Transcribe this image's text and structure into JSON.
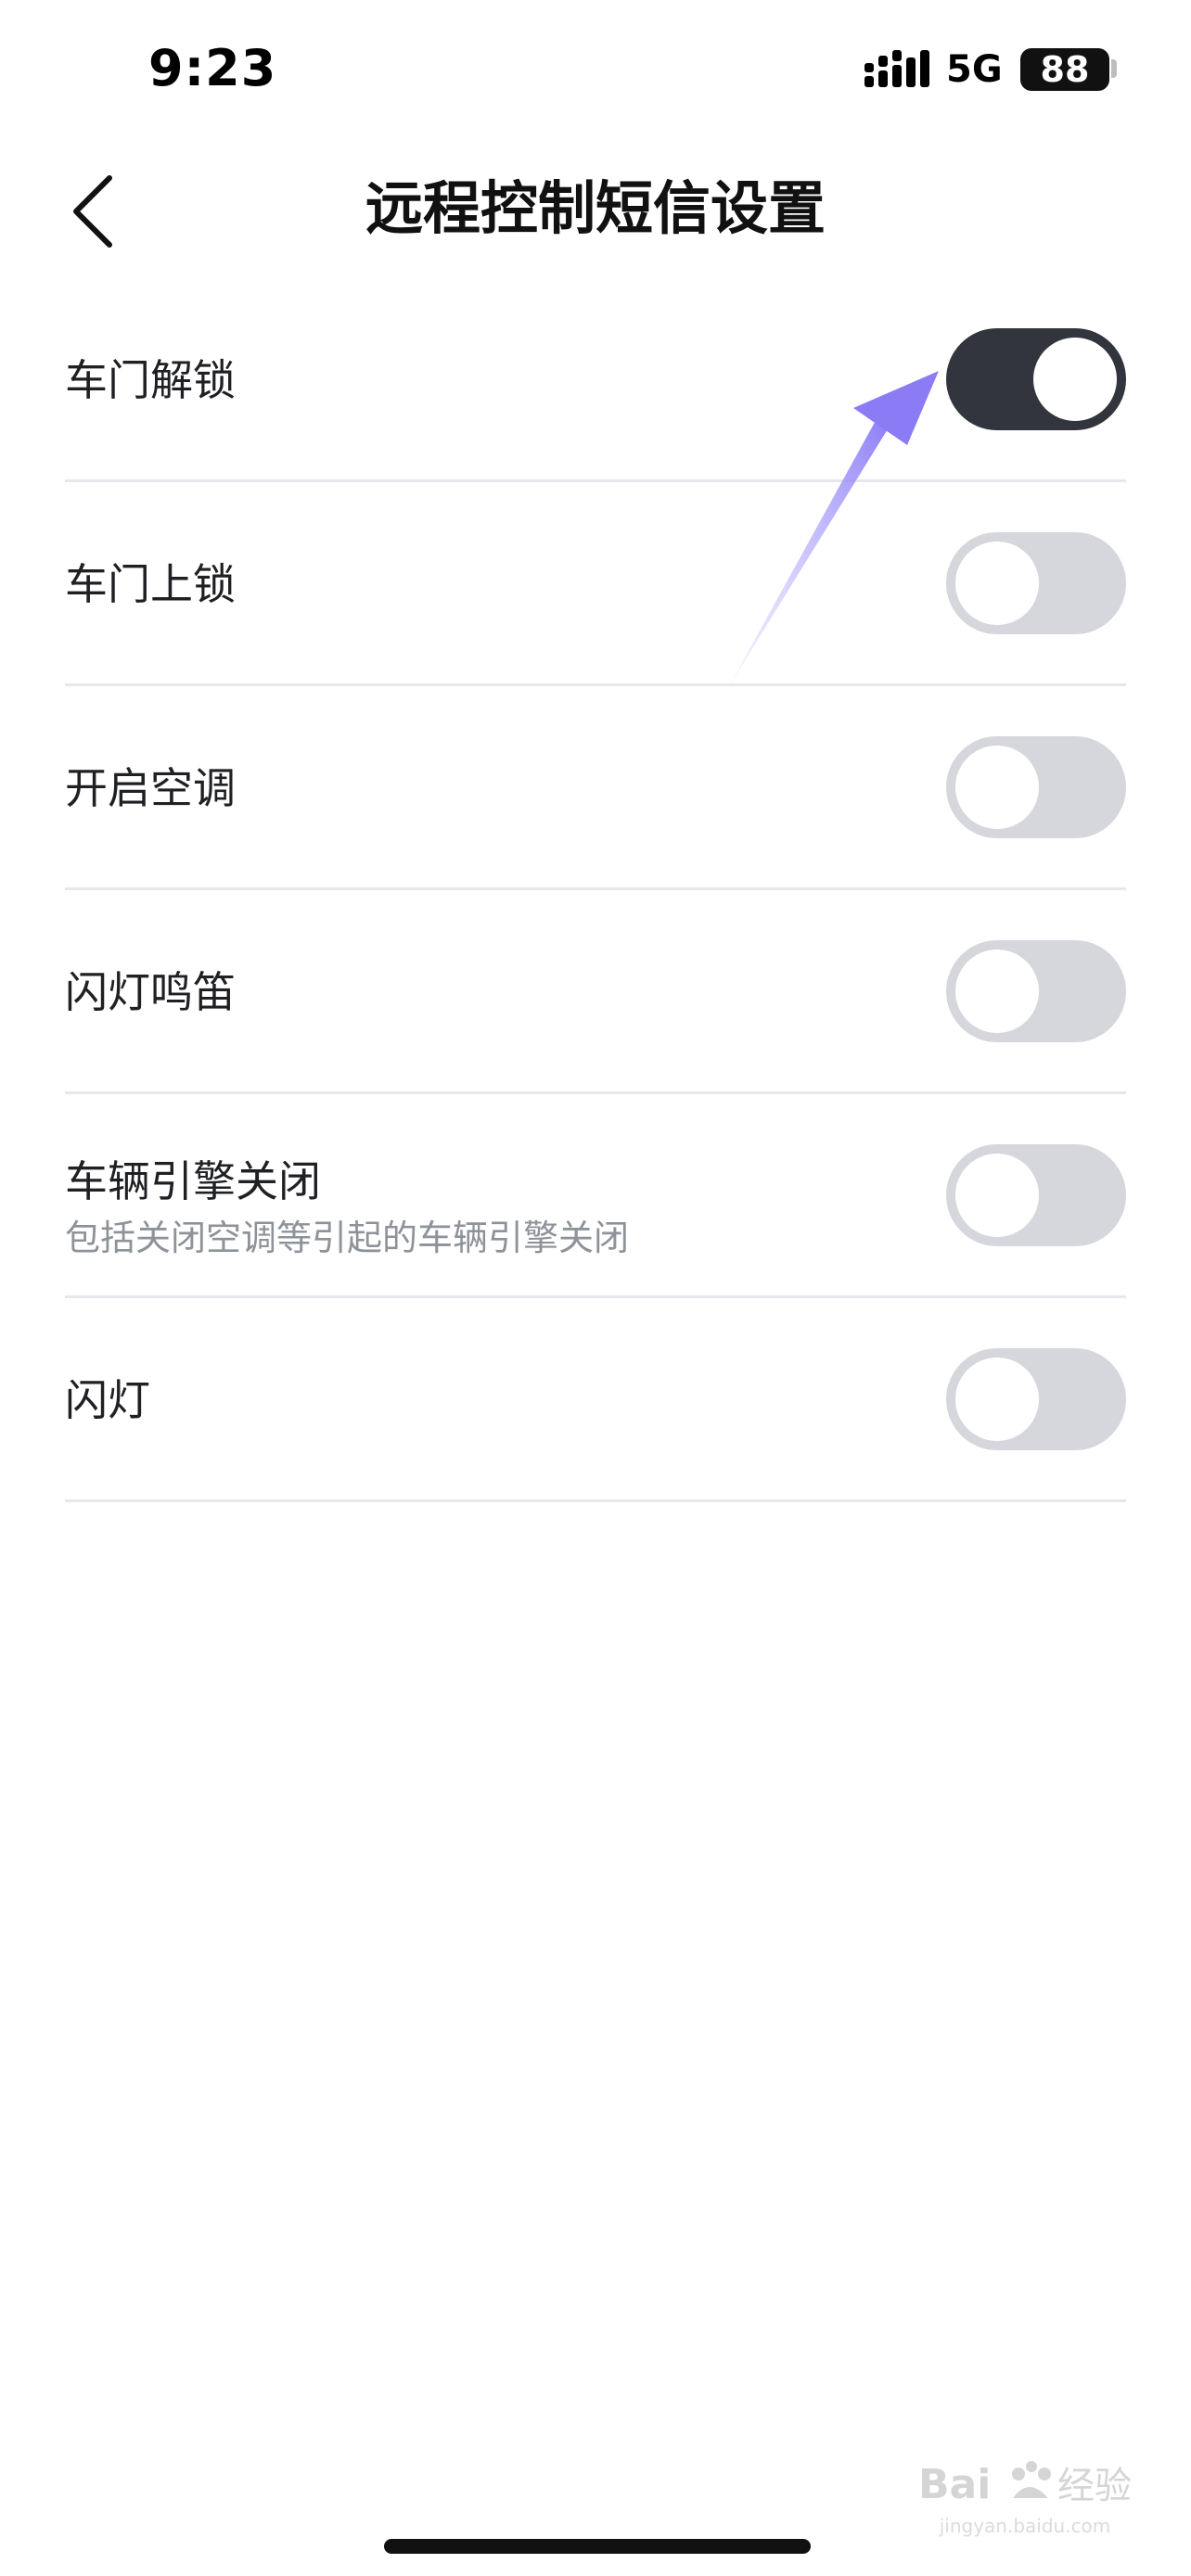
{
  "status_bar": {
    "time": "9:23",
    "network": "5G",
    "battery": "88"
  },
  "nav": {
    "title": "远程控制短信设置"
  },
  "settings": [
    {
      "label": "车门解锁",
      "sub": "",
      "enabled": true
    },
    {
      "label": "车门上锁",
      "sub": "",
      "enabled": false
    },
    {
      "label": "开启空调",
      "sub": "",
      "enabled": false
    },
    {
      "label": "闪灯鸣笛",
      "sub": "",
      "enabled": false
    },
    {
      "label": "车辆引擎关闭",
      "sub": "包括关闭空调等引起的车辆引擎关闭",
      "enabled": false
    },
    {
      "label": "闪灯",
      "sub": "",
      "enabled": false
    }
  ],
  "colors": {
    "toggle_on": "#33353e",
    "toggle_off": "#d5d7dc",
    "arrow": "#8b7cf6"
  },
  "watermark": {
    "logo": "Baidu经验",
    "url": "jingyan.baidu.com"
  }
}
